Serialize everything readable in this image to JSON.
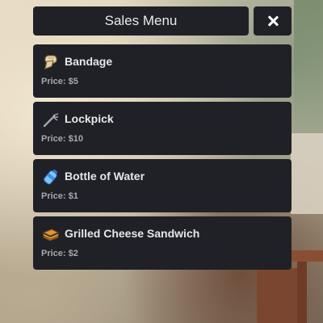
{
  "menu": {
    "title": "Sales Menu",
    "close_label": "✕"
  },
  "items": [
    {
      "name": "Bandage",
      "price": "Price: $5",
      "icon": "bandage-icon"
    },
    {
      "name": "Lockpick",
      "price": "Price: $10",
      "icon": "lockpick-icon"
    },
    {
      "name": "Bottle of Water",
      "price": "Price: $1",
      "icon": "water-bottle-icon"
    },
    {
      "name": "Grilled Cheese Sandwich",
      "price": "Price: $2",
      "icon": "sandwich-icon"
    }
  ],
  "colors": {
    "panel": "#202127",
    "text": "#e6e6ea",
    "price_text": "#a8a9ae"
  }
}
